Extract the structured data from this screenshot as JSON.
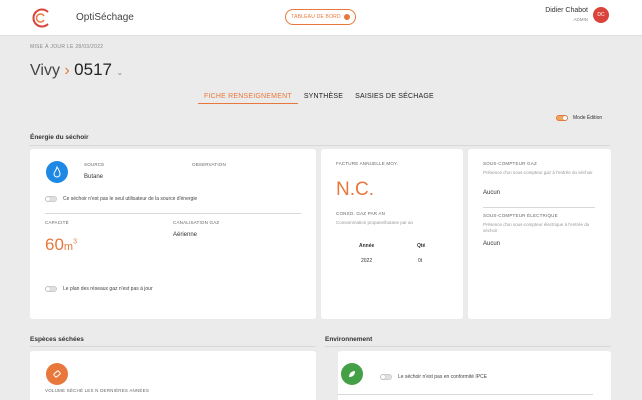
{
  "header": {
    "app_name": "OptiSéchage",
    "dashboard_label": "TABLEAU DE BORD",
    "user_name": "Didier Chabot",
    "user_role": "ADMIN",
    "avatar_initials": "DC"
  },
  "page": {
    "updated": "MISE À JOUR LE 28/03/2022",
    "site": "Vivy",
    "separator": "›",
    "number": "0517",
    "chevron": "⌄"
  },
  "tabs": [
    {
      "label": "FICHE RENSEIGNEMENT",
      "active": true
    },
    {
      "label": "SYNTHÈSE",
      "active": false
    },
    {
      "label": "SAISIES DE SÉCHAGE",
      "active": false
    }
  ],
  "edit_mode": {
    "label": "Mode Édition",
    "on": true
  },
  "energy": {
    "title": "Énergie du séchoir",
    "source_label": "SOURCE",
    "source_value": "Butane",
    "observation_label": "OBSERVATION",
    "not_only_user": "Ce séchoir n'est pas le seul utilisateur de la source d'énergie",
    "capacity_label": "CAPACITÉ",
    "capacity_value": "60",
    "capacity_unit": "m",
    "capacity_exp": "3",
    "canalisation_label": "CANALISATION GAZ",
    "canalisation_value": "Aérienne",
    "network_plan": "Le plan des réseaux gaz n'est pas à jour"
  },
  "invoice": {
    "label": "FACTURE ANNUELLE MOY.",
    "value": "N.C.",
    "conso_label": "CONSO. GAZ PAR AN",
    "conso_hint": "Consommation propane/butane par an",
    "col_year": "Année",
    "col_qty": "Qté",
    "year": "2022",
    "qty": "0t"
  },
  "meters": {
    "gas_label": "SOUS-COMPTEUR GAZ",
    "gas_hint": "Présence d'un sous-compteur gaz à l'entrée du séchoir",
    "gas_value": "Aucun",
    "elec_label": "SOUS-COMPTEUR ÉLECTRIQUE",
    "elec_hint": "Présence d'un sous-compteur électrique à l'entrée du séchoir",
    "elec_value": "Aucun"
  },
  "species": {
    "title": "Espèces séchées",
    "volume_label": "VOLUME SÉCHÉ LES N DERNIÈRES ANNÉES"
  },
  "environment": {
    "title": "Environnement",
    "ipce": "Le séchoir n'est pas en conformité IPCE"
  },
  "colors": {
    "accent": "#e8773b",
    "source_icon": "#1e88e5",
    "env_icon": "#43a047",
    "avatar": "#d9433b"
  }
}
